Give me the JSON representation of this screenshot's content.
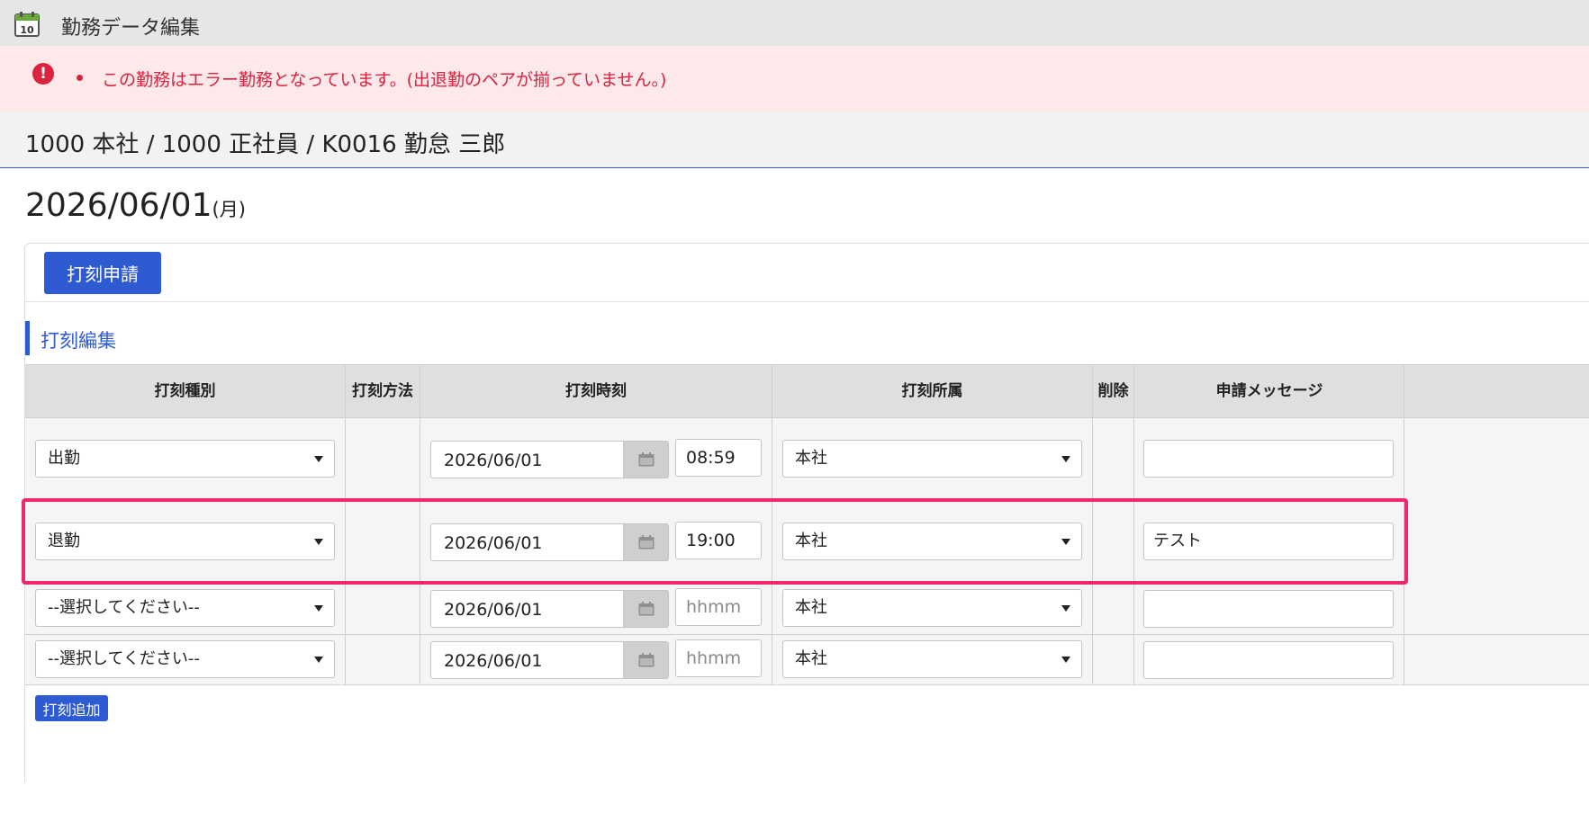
{
  "window": {
    "title": "勤務データ編集",
    "icon_day": "10"
  },
  "alert": {
    "message": "この勤務はエラー勤務となっています。(出退勤のペアが揃っていません。)"
  },
  "employee": {
    "line": "1000 本社 / 1000 正社員 / K0016 勤怠 三郎"
  },
  "date": {
    "main": "2026/06/01",
    "weekday": "(月)"
  },
  "buttons": {
    "stamp_request": "打刻申請",
    "add_stamp": "打刻追加"
  },
  "section": {
    "title": "打刻編集"
  },
  "table": {
    "headers": {
      "type": "打刻種別",
      "method": "打刻方法",
      "time": "打刻時刻",
      "affiliation": "打刻所属",
      "delete": "削除",
      "message": "申請メッセージ"
    },
    "rows": [
      {
        "type": "出勤",
        "date": "2026/06/01",
        "time": "08:59",
        "time_placeholder": "",
        "affiliation": "本社",
        "message": ""
      },
      {
        "type": "退勤",
        "date": "2026/06/01",
        "time": "19:00",
        "time_placeholder": "",
        "affiliation": "本社",
        "message": "テスト"
      },
      {
        "type": "--選択してください--",
        "date": "2026/06/01",
        "time": "",
        "time_placeholder": "hhmm",
        "affiliation": "本社",
        "message": ""
      },
      {
        "type": "--選択してください--",
        "date": "2026/06/01",
        "time": "",
        "time_placeholder": "hhmm",
        "affiliation": "本社",
        "message": ""
      }
    ]
  },
  "colors": {
    "accent": "#2e5bd1",
    "error": "#d9233f",
    "highlight": "#f0286a"
  }
}
